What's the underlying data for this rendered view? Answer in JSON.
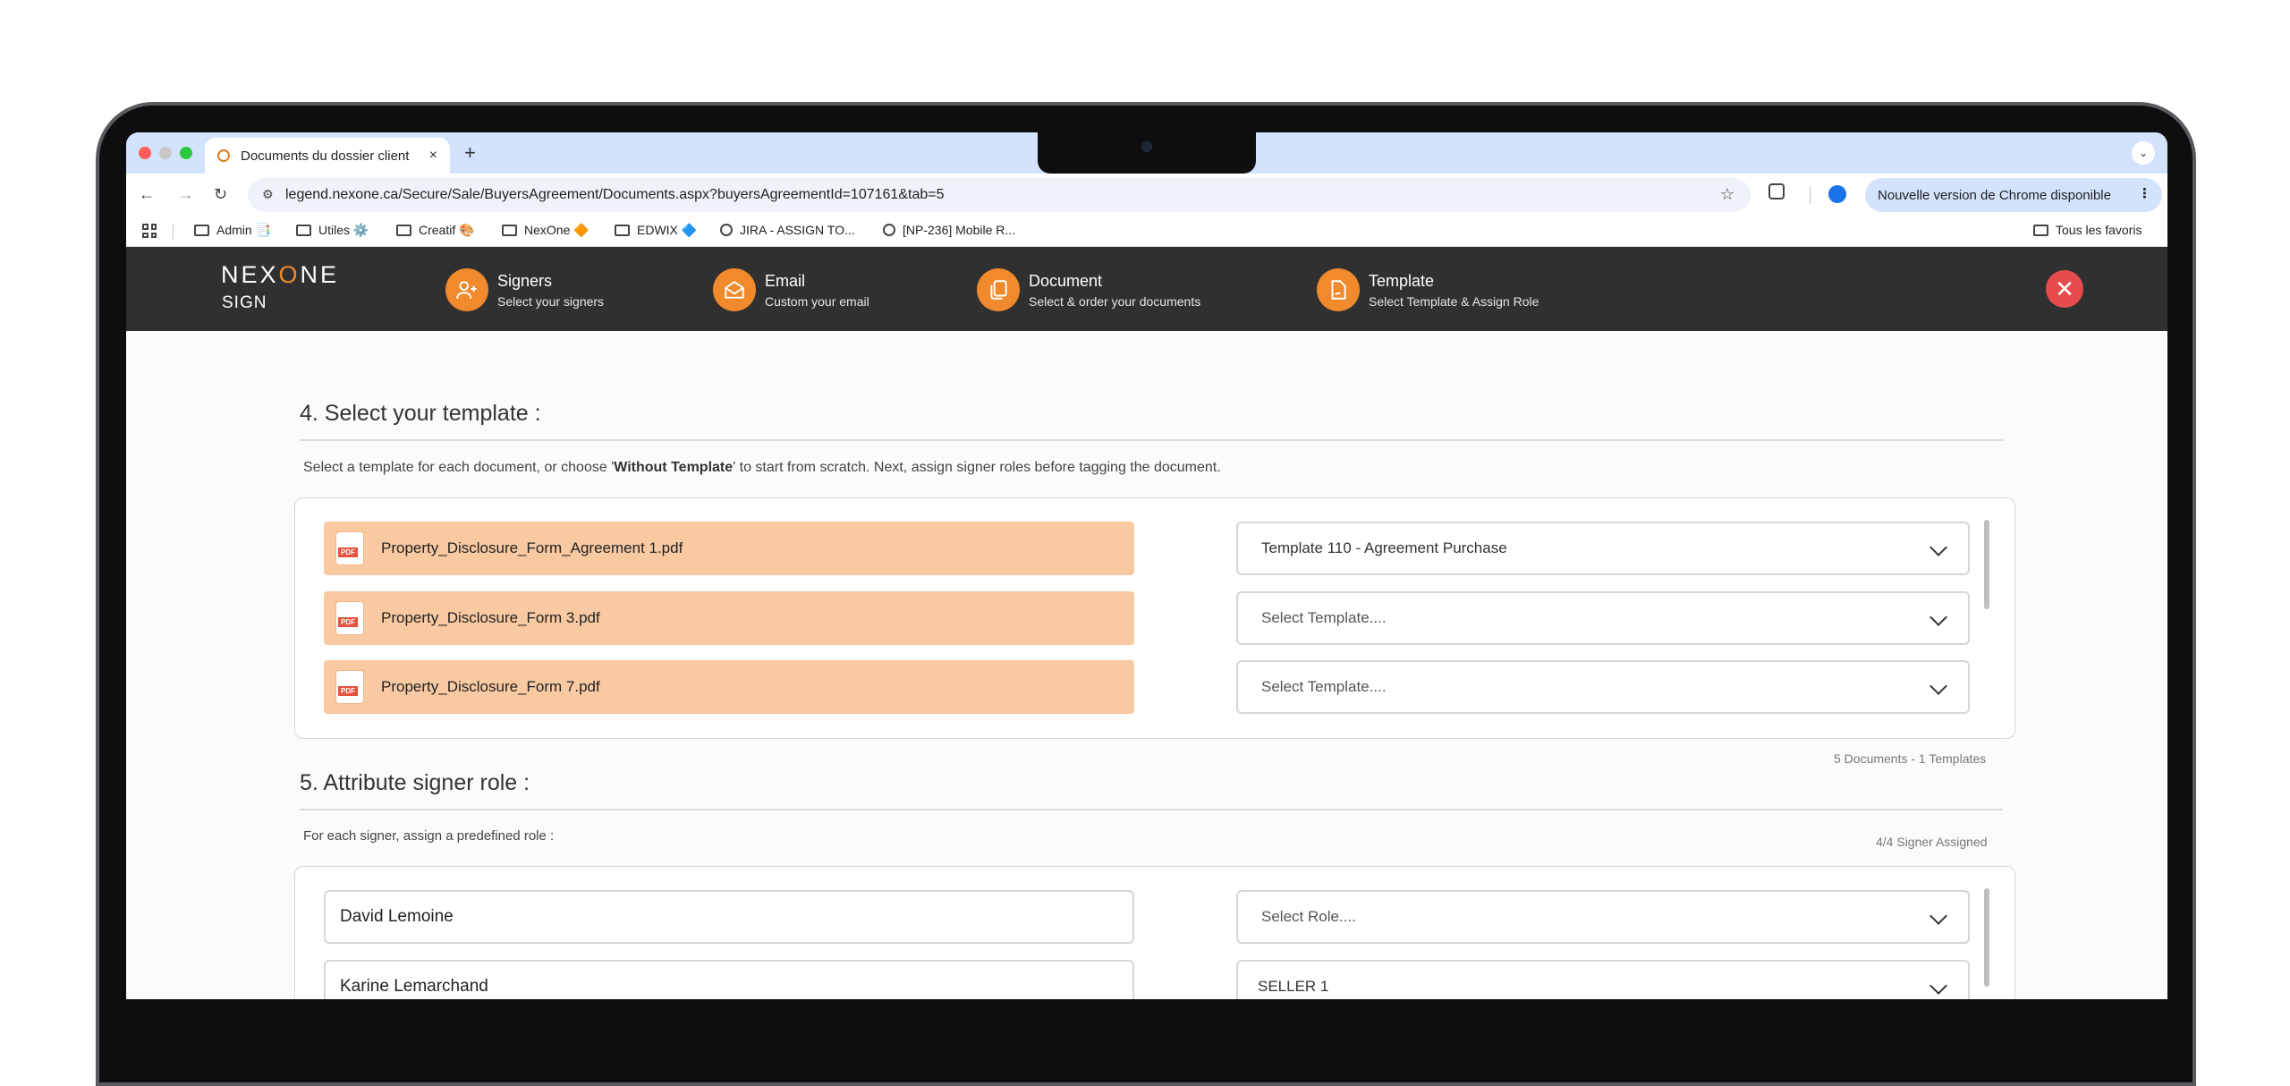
{
  "browser": {
    "tab_title": "Documents du dossier client",
    "tab_close": "×",
    "new_tab": "+",
    "url": "legend.nexone.ca/Secure/Sale/BuyersAgreement/Documents.aspx?buyersAgreementId=107161&tab=5",
    "update_label": "Nouvelle version de Chrome disponible",
    "bookmarks": [
      {
        "label": "Admin 📑",
        "icon": "folder-icon"
      },
      {
        "label": "Utiles ⚙️",
        "icon": "folder-icon"
      },
      {
        "label": "Creatif 🎨",
        "icon": "folder-icon"
      },
      {
        "label": "NexOne 🔶",
        "icon": "folder-icon"
      },
      {
        "label": "EDWIX 🔷",
        "icon": "folder-icon"
      },
      {
        "label": "JIRA - ASSIGN TO...",
        "icon": "jira-icon"
      },
      {
        "label": "[NP-236] Mobile R...",
        "icon": "jira-icon"
      }
    ],
    "all_bookmarks": "Tous les favoris"
  },
  "app": {
    "logo_prefix": "NEX",
    "logo_o": "O",
    "logo_suffix": "NE",
    "logo_sub": "SIGN",
    "steps": [
      {
        "title": "Signers",
        "subtitle": "Select your signers",
        "icon": "add-user-icon"
      },
      {
        "title": "Email",
        "subtitle": "Custom your email",
        "icon": "envelope-icon"
      },
      {
        "title": "Document",
        "subtitle": "Select & order your documents",
        "icon": "documents-icon"
      },
      {
        "title": "Template",
        "subtitle": "Select Template & Assign Role",
        "icon": "template-icon"
      }
    ],
    "close_label": "✕"
  },
  "template_section": {
    "title": "4. Select your template :",
    "desc_before": "Select a template for each document, or choose '",
    "desc_bold": "Without Template",
    "desc_after": "' to start from scratch. Next, assign signer roles before tagging the document.",
    "pdf_badge": "PDF",
    "documents": [
      {
        "name": "Property_Disclosure_Form_Agreement 1.pdf",
        "template": "Template 110 - Agreement Purchase"
      },
      {
        "name": "Property_Disclosure_Form 3.pdf",
        "template": "Select Template...."
      },
      {
        "name": "Property_Disclosure_Form 7.pdf",
        "template": "Select Template...."
      }
    ],
    "summary": "5 Documents - 1 Templates"
  },
  "role_section": {
    "title": "5. Attribute signer role :",
    "desc": "For each signer, assign a predefined role :",
    "assigned": "4/4 Signer Assigned",
    "signers": [
      {
        "name": "David Lemoine",
        "role": "Select Role...."
      },
      {
        "name": "Karine Lemarchand",
        "role": "SELLER 1"
      }
    ]
  }
}
